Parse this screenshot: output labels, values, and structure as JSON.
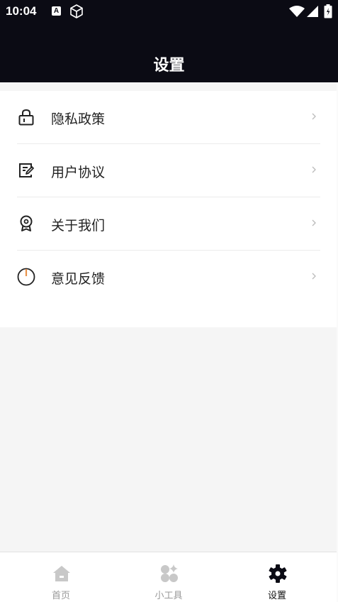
{
  "status_bar": {
    "time": "10:04",
    "a_badge": "A",
    "icons": [
      "cube-icon",
      "wifi-icon",
      "signal-icon",
      "battery-icon"
    ]
  },
  "header": {
    "title": "设置",
    "background_color": "#0b0b14"
  },
  "settings": {
    "items": [
      {
        "label": "隐私政策",
        "icon": "lock-icon"
      },
      {
        "label": "用户协议",
        "icon": "edit-document-icon"
      },
      {
        "label": "关于我们",
        "icon": "award-icon"
      },
      {
        "label": "意见反馈",
        "icon": "power-icon"
      }
    ],
    "accent_color": "#e8924a"
  },
  "bottom_nav": {
    "tabs": [
      {
        "label": "首页",
        "icon": "home-icon",
        "active": false
      },
      {
        "label": "小工具",
        "icon": "tools-icon",
        "active": false
      },
      {
        "label": "设置",
        "icon": "settings-gear-icon",
        "active": true
      }
    ]
  }
}
